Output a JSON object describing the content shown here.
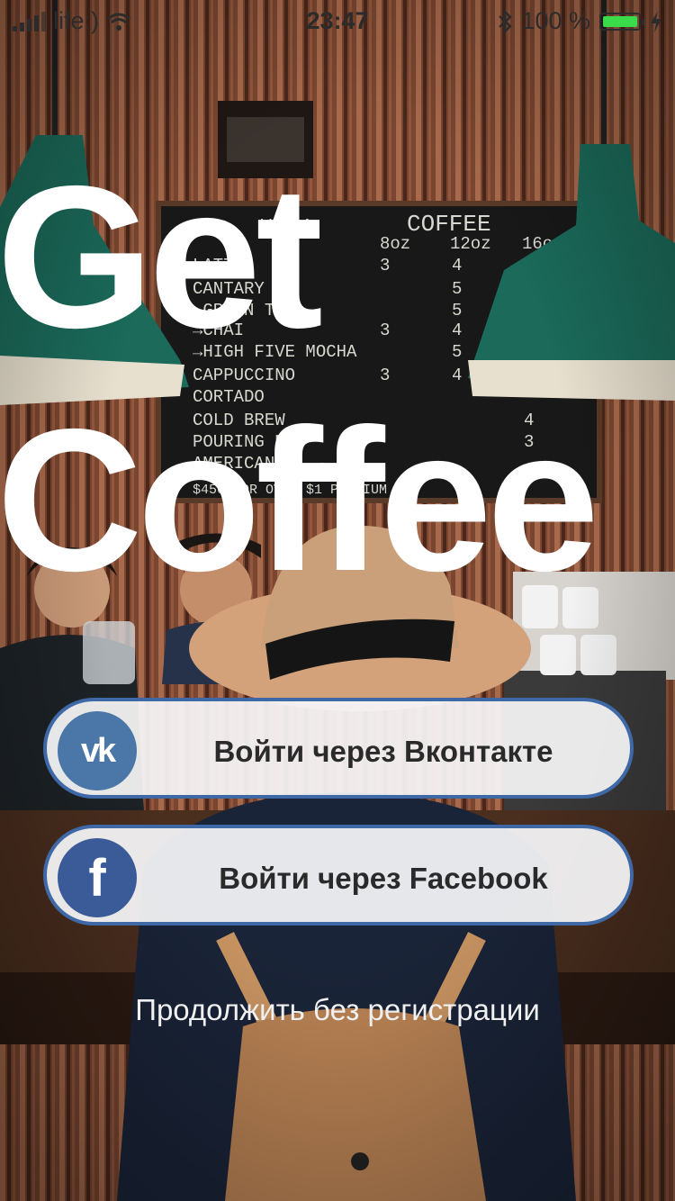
{
  "status_bar": {
    "carrier": "life:)",
    "time": "23:47",
    "battery_percent": "100 %",
    "battery_level": 1.0,
    "battery_color": "#3adb4a"
  },
  "app": {
    "title_line1": "Get",
    "title_line2": "Coffee"
  },
  "login": {
    "vk_icon": "vk",
    "vk_label": "Войти через Вконтакте",
    "fb_icon": "f",
    "fb_label": "Войти через Facebook",
    "skip_label": "Продолжить без регистрации"
  },
  "colors": {
    "button_border": "#3f69a6",
    "vk_brand": "#4a76a8",
    "fb_brand": "#3b5a98"
  }
}
